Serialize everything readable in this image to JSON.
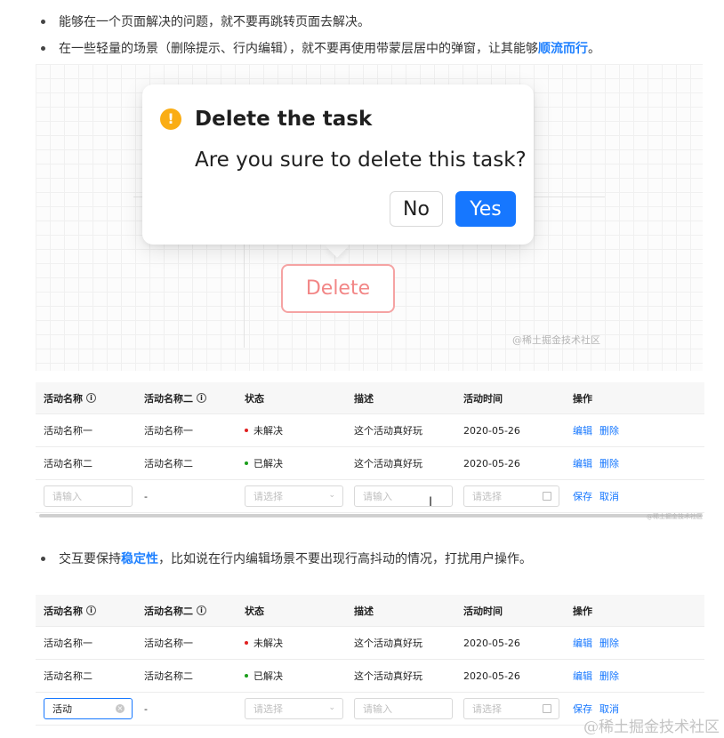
{
  "bullets": {
    "b1": "能够在一个页面解决的问题，就不要再跳转页面去解决。",
    "b2_pre": "在一些轻量的场景（删除提示、行内编辑），就不要再使用带蒙层居中的弹窗，让其能够",
    "b2_strong": "顺流而行",
    "b2_post": "。",
    "b3_pre": "交互要保持",
    "b3_strong": "稳定性",
    "b3_post": "，比如说在行内编辑场景不要出现行高抖动的情况，打扰用户操作。"
  },
  "popconfirm": {
    "icon": "!",
    "title": "Delete the task",
    "description": "Are you sure to delete this task?",
    "no_label": "No",
    "yes_label": "Yes"
  },
  "delete_button": "Delete",
  "watermarks": {
    "demo": "@稀土掘金技术社区",
    "table1": "@稀土掘金技术社区",
    "page": "@稀土掘金技术社区"
  },
  "colors": {
    "primary": "#1677ff",
    "warning": "#faad14",
    "danger": "#f28686",
    "unresolved": "#e02020",
    "resolved": "#1a9d1a"
  },
  "table": {
    "headers": [
      "活动名称",
      "活动名称二",
      "状态",
      "描述",
      "活动时间",
      "操作"
    ],
    "rows": [
      {
        "name": "活动名称一",
        "name2": "活动名称一",
        "status": "未解决",
        "desc": "这个活动真好玩",
        "date": "2020-05-26",
        "edit": "编辑",
        "delete": "删除"
      },
      {
        "name": "活动名称二",
        "name2": "活动名称二",
        "status": "已解决",
        "desc": "这个活动真好玩",
        "date": "2020-05-26",
        "edit": "编辑",
        "delete": "删除"
      }
    ],
    "edit_row": {
      "name_placeholder": "请输入",
      "name_value": "活动",
      "name2": "-",
      "status_placeholder": "请选择",
      "desc_placeholder": "请输入",
      "date_placeholder": "请选择",
      "save": "保存",
      "cancel": "取消"
    }
  }
}
